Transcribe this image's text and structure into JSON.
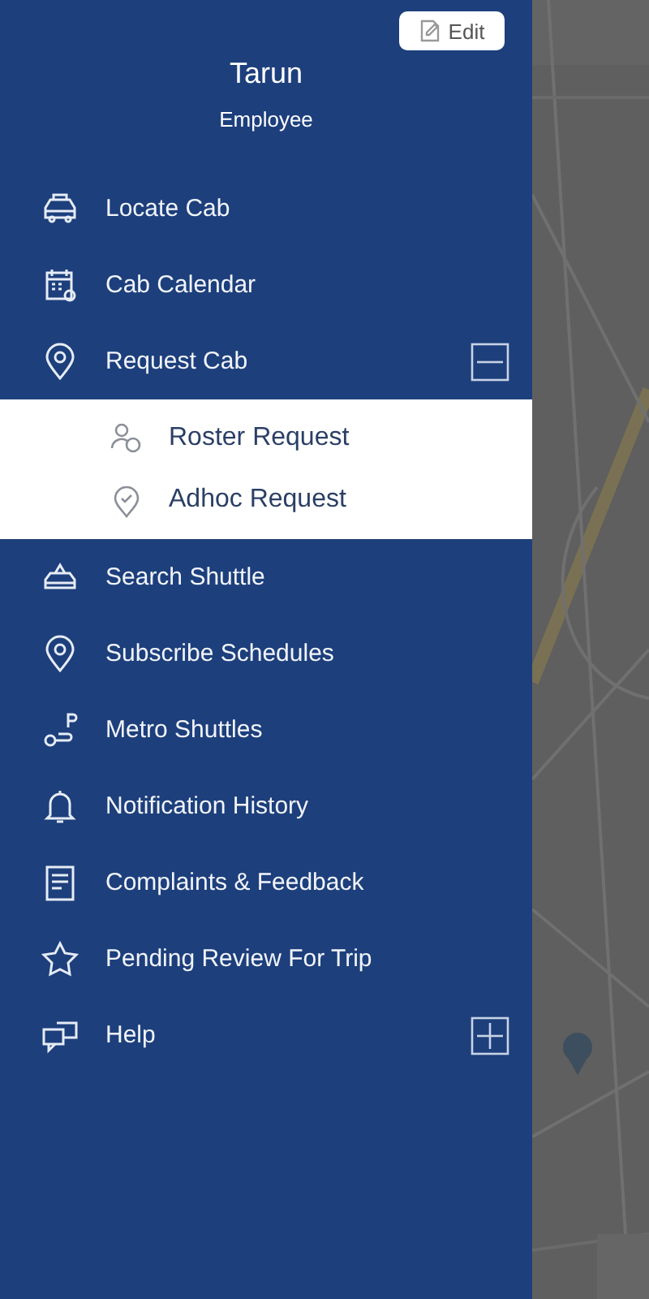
{
  "profile": {
    "edit_label": "Edit",
    "name": "Tarun",
    "role": "Employee"
  },
  "menu": [
    {
      "label": "Locate Cab"
    },
    {
      "label": "Cab Calendar"
    },
    {
      "label": "Request Cab",
      "expanded": true,
      "children": [
        {
          "label": "Roster Request"
        },
        {
          "label": "Adhoc Request"
        }
      ]
    },
    {
      "label": "Search Shuttle"
    },
    {
      "label": "Subscribe Schedules"
    },
    {
      "label": "Metro Shuttles"
    },
    {
      "label": "Notification History"
    },
    {
      "label": "Complaints & Feedback"
    },
    {
      "label": "Pending Review For Trip"
    },
    {
      "label": "Help",
      "expanded": false
    }
  ]
}
